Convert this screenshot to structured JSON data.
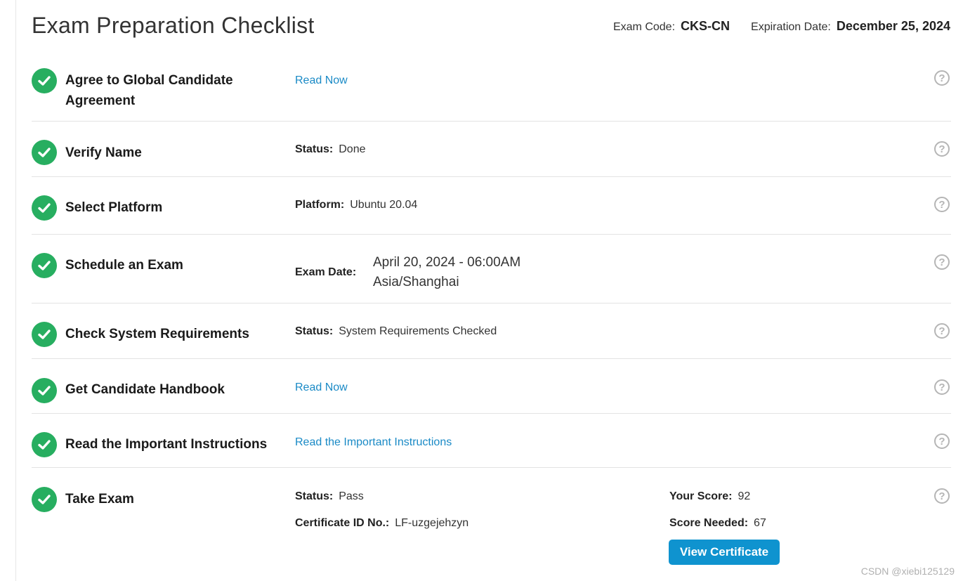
{
  "header": {
    "title": "Exam Preparation Checklist",
    "exam_code_label": "Exam Code:",
    "exam_code": "CKS-CN",
    "expiration_label": "Expiration Date:",
    "expiration_date": "December 25, 2024"
  },
  "steps": [
    {
      "title": "Agree to Global Candidate Agreement",
      "link": "Read Now"
    },
    {
      "title": "Verify Name",
      "label": "Status:",
      "value": "Done"
    },
    {
      "title": "Select Platform",
      "label": "Platform:",
      "value": "Ubuntu 20.04"
    },
    {
      "title": "Schedule an Exam",
      "label": "Exam Date:",
      "value_line1": "April 20, 2024 - 06:00AM",
      "value_line2": "Asia/Shanghai"
    },
    {
      "title": "Check System Requirements",
      "label": "Status:",
      "value": "System Requirements Checked"
    },
    {
      "title": "Get Candidate Handbook",
      "link": "Read Now"
    },
    {
      "title": "Read the Important Instructions",
      "link": "Read the Important Instructions"
    },
    {
      "title": "Take Exam",
      "status_label": "Status:",
      "status_value": "Pass",
      "cert_label": "Certificate ID No.:",
      "cert_value": "LF-uzgejehzyn",
      "score_label": "Your Score:",
      "score_value": "92",
      "needed_label": "Score Needed:",
      "needed_value": "67",
      "button": "View Certificate"
    }
  ],
  "help_glyph": "?",
  "icons": {
    "done": "check-circle-icon",
    "help": "help-circle-icon"
  },
  "colors": {
    "check": "#27ae60",
    "link": "#1a8ac6",
    "button": "#0f93cf"
  },
  "watermark": "CSDN @xiebi125129"
}
